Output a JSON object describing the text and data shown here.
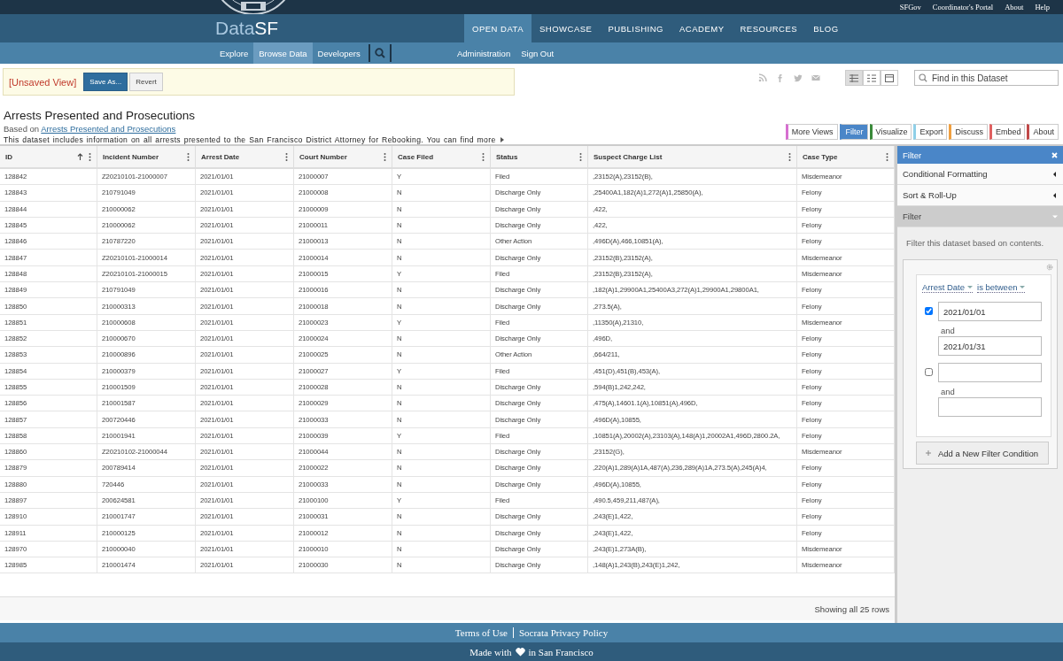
{
  "top_links": [
    "SFGov",
    "Coordinator's Portal",
    "About",
    "Help"
  ],
  "logo": {
    "part1": "Data",
    "part2": "SF"
  },
  "main_nav": [
    {
      "label": "OPEN DATA",
      "selected": true
    },
    {
      "label": "SHOWCASE",
      "selected": false
    },
    {
      "label": "PUBLISHING",
      "selected": false
    },
    {
      "label": "ACADEMY",
      "selected": false
    },
    {
      "label": "RESOURCES",
      "selected": false
    },
    {
      "label": "BLOG",
      "selected": false
    }
  ],
  "sub_nav": [
    {
      "label": "Explore",
      "selected": false
    },
    {
      "label": "Browse Data",
      "selected": true
    },
    {
      "label": "Developers",
      "selected": false
    }
  ],
  "sub_nav_right": [
    "Administration",
    "Sign Out"
  ],
  "view_banner": {
    "status": "[Unsaved View]",
    "buttons": [
      {
        "label": "Save As...",
        "kind": "primary"
      },
      {
        "label": "Revert",
        "kind": "secondary"
      }
    ]
  },
  "view_modes": [
    {
      "selected": true
    },
    {
      "selected": false
    },
    {
      "selected": false
    }
  ],
  "search": {
    "placeholder": "Find in this Dataset"
  },
  "dataset": {
    "title": "Arrests Presented and Prosecutions",
    "based_on_label": "Based on",
    "based_on_link": "Arrests Presented and Prosecutions",
    "description": "This dataset includes information on all arrests presented to the San Francisco District Attorney for Rebooking. You can find more"
  },
  "pane_tabs": [
    {
      "label": "More Views",
      "color": "#d66fd0",
      "selected": false
    },
    {
      "label": "Filter",
      "color": "#4a86c8",
      "selected": true
    },
    {
      "label": "Visualize",
      "color": "#3a8a3a",
      "selected": false
    },
    {
      "label": "Export",
      "color": "#8fd0e8",
      "selected": false
    },
    {
      "label": "Discuss",
      "color": "#f0a040",
      "selected": false
    },
    {
      "label": "Embed",
      "color": "#e06060",
      "selected": false
    },
    {
      "label": "About",
      "color": "#c04848",
      "selected": false
    }
  ],
  "table": {
    "columns": [
      {
        "label": "ID",
        "sorted": true
      },
      {
        "label": "Incident Number",
        "sorted": false
      },
      {
        "label": "Arrest Date",
        "sorted": false
      },
      {
        "label": "Court Number",
        "sorted": false
      },
      {
        "label": "Case Filed",
        "sorted": false
      },
      {
        "label": "Status",
        "sorted": false
      },
      {
        "label": "Suspect Charge List",
        "sorted": false
      },
      {
        "label": "Case Type",
        "sorted": false
      }
    ],
    "rows": [
      [
        "128842",
        "Z20210101-21000007",
        "2021/01/01",
        "21000007",
        "Y",
        "Filed",
        ",23152(A),23152(B),",
        "Misdemeanor"
      ],
      [
        "128843",
        "210791049",
        "2021/01/01",
        "21000008",
        "N",
        "Discharge Only",
        ",25400A1,182(A)1,272(A)1,25850(A),",
        "Felony"
      ],
      [
        "128844",
        "210000062",
        "2021/01/01",
        "21000009",
        "N",
        "Discharge Only",
        ",422,",
        "Felony"
      ],
      [
        "128845",
        "210000062",
        "2021/01/01",
        "21000011",
        "N",
        "Discharge Only",
        ",422,",
        "Felony"
      ],
      [
        "128846",
        "210787220",
        "2021/01/01",
        "21000013",
        "N",
        "Other Action",
        ",496D(A),466,10851(A),",
        "Felony"
      ],
      [
        "128847",
        "Z20210101-21000014",
        "2021/01/01",
        "21000014",
        "N",
        "Discharge Only",
        ",23152(B),23152(A),",
        "Misdemeanor"
      ],
      [
        "128848",
        "Z20210101-21000015",
        "2021/01/01",
        "21000015",
        "Y",
        "Filed",
        ",23152(B),23152(A),",
        "Misdemeanor"
      ],
      [
        "128849",
        "210791049",
        "2021/01/01",
        "21000016",
        "N",
        "Discharge Only",
        ",182(A)1,29900A1,25400A3,272(A)1,29900A1,29800A1,",
        "Felony"
      ],
      [
        "128850",
        "210000313",
        "2021/01/01",
        "21000018",
        "N",
        "Discharge Only",
        ",273.5(A),",
        "Felony"
      ],
      [
        "128851",
        "210000608",
        "2021/01/01",
        "21000023",
        "Y",
        "Filed",
        ",11350(A),21310,",
        "Misdemeanor"
      ],
      [
        "128852",
        "210000670",
        "2021/01/01",
        "21000024",
        "N",
        "Discharge Only",
        ",496D,",
        "Felony"
      ],
      [
        "128853",
        "210000896",
        "2021/01/01",
        "21000025",
        "N",
        "Other Action",
        ",664/211,",
        "Felony"
      ],
      [
        "128854",
        "210000379",
        "2021/01/01",
        "21000027",
        "Y",
        "Filed",
        ",451(D),451(B),453(A),",
        "Felony"
      ],
      [
        "128855",
        "210001509",
        "2021/01/01",
        "21000028",
        "N",
        "Discharge Only",
        ",594(B)1,242,242,",
        "Felony"
      ],
      [
        "128856",
        "210001587",
        "2021/01/01",
        "21000029",
        "N",
        "Discharge Only",
        ",475(A),14601.1(A),10851(A),496D,",
        "Felony"
      ],
      [
        "128857",
        "200720446",
        "2021/01/01",
        "21000033",
        "N",
        "Discharge Only",
        ",496D(A),10855,",
        "Felony"
      ],
      [
        "128858",
        "210001941",
        "2021/01/01",
        "21000039",
        "Y",
        "Filed",
        ",10851(A),20002(A),23103(A),148(A)1,20002A1,496D,2800.2A,",
        "Felony"
      ],
      [
        "128860",
        "Z20210102-21000044",
        "2021/01/01",
        "21000044",
        "N",
        "Discharge Only",
        ",23152(G),",
        "Misdemeanor"
      ],
      [
        "128879",
        "200789414",
        "2021/01/01",
        "21000022",
        "N",
        "Discharge Only",
        ",220(A)1,289(A)1A,487(A),236,289(A)1A,273.5(A),245(A)4,",
        "Felony"
      ],
      [
        "128880",
        "720446",
        "2021/01/01",
        "21000033",
        "N",
        "Discharge Only",
        ",496D(A),10855,",
        "Felony"
      ],
      [
        "128897",
        "200624581",
        "2021/01/01",
        "21000100",
        "Y",
        "Filed",
        ",490.5,459,211,487(A),",
        "Felony"
      ],
      [
        "128910",
        "210001747",
        "2021/01/01",
        "21000031",
        "N",
        "Discharge Only",
        ",243(E)1,422,",
        "Felony"
      ],
      [
        "128911",
        "210000125",
        "2021/01/01",
        "21000012",
        "N",
        "Discharge Only",
        ",243(E)1,422,",
        "Felony"
      ],
      [
        "128970",
        "210000040",
        "2021/01/01",
        "21000010",
        "N",
        "Discharge Only",
        ",243(E)1,273A(B),",
        "Misdemeanor"
      ],
      [
        "128985",
        "210001474",
        "2021/01/01",
        "21000030",
        "N",
        "Discharge Only",
        ",148(A)1,243(B),243(E)1,242,",
        "Misdemeanor"
      ]
    ],
    "footer": "Showing all 25 rows"
  },
  "side_panel": {
    "title": "Filter",
    "sections": [
      {
        "label": "Conditional Formatting",
        "expanded": false
      },
      {
        "label": "Sort & Roll-Up",
        "expanded": false
      },
      {
        "label": "Filter",
        "expanded": true
      }
    ],
    "hint": "Filter this dataset based on contents.",
    "condition": {
      "column": "Arrest Date",
      "operator": "is between",
      "values": [
        {
          "checked": true,
          "from": "2021/01/01",
          "joiner": "and",
          "to": "2021/01/31"
        },
        {
          "checked": false,
          "joiner": "and"
        }
      ]
    },
    "add_button": "Add a New Filter Condition"
  },
  "page_footer": {
    "links": [
      "Terms of Use",
      "Socrata Privacy Policy"
    ],
    "made_with_before": "Made with",
    "made_with_after": "in San Francisco"
  }
}
